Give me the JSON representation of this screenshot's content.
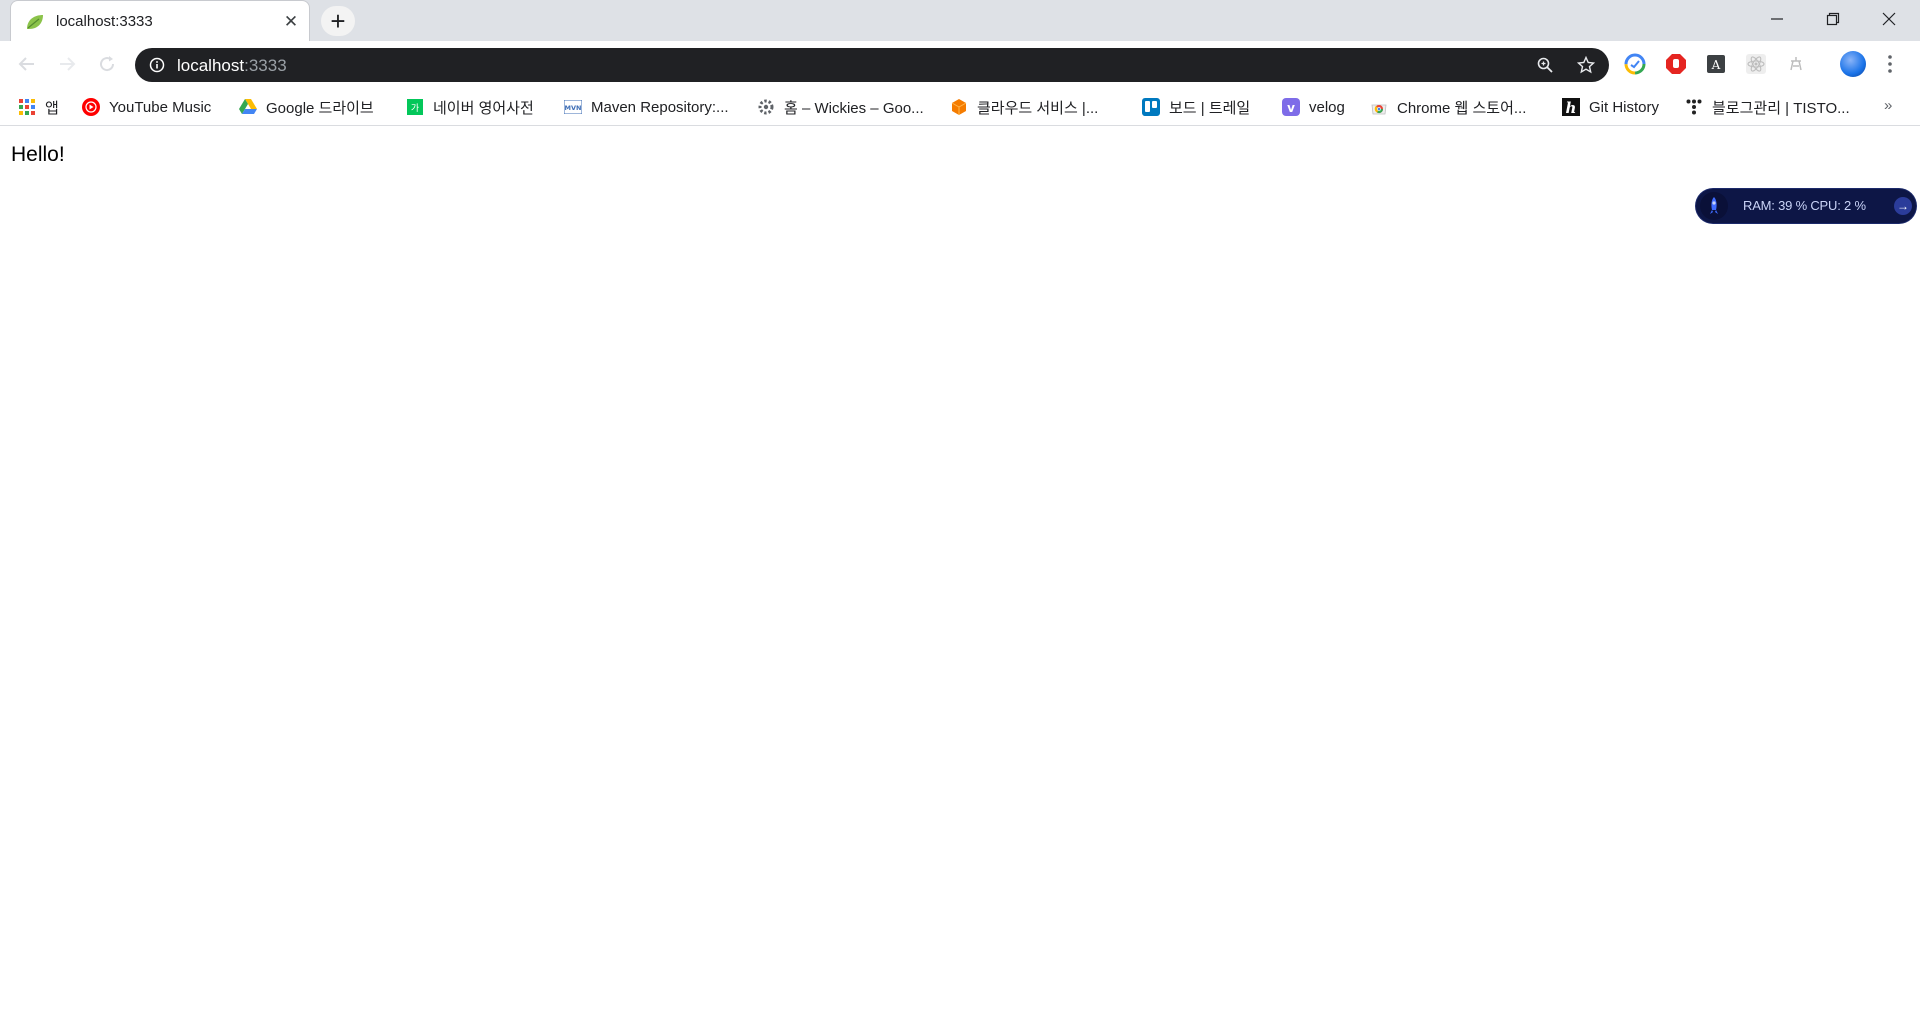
{
  "tab": {
    "title": "localhost:3333",
    "close": "✕"
  },
  "newtab": {
    "label": "+"
  },
  "window": {
    "minimize": "—",
    "restore": "❐",
    "close": "✕"
  },
  "omnibox": {
    "host": "localhost",
    "port": ":3333"
  },
  "bookmarks": [
    {
      "label": "앱",
      "icon": "apps-grid-icon"
    },
    {
      "label": "YouTube Music",
      "icon": "youtube-music-icon"
    },
    {
      "label": "Google 드라이브",
      "icon": "google-drive-icon"
    },
    {
      "label": "네이버 영어사전",
      "icon": "naver-dictionary-icon"
    },
    {
      "label": "Maven Repository:...",
      "icon": "maven-icon"
    },
    {
      "label": "홈 – Wickies – Goo...",
      "icon": "gear-icon"
    },
    {
      "label": "클라우드 서비스 |...",
      "icon": "cloud-cube-icon"
    },
    {
      "label": "보드 | 트레일",
      "icon": "trello-icon"
    },
    {
      "label": "velog",
      "icon": "velog-icon"
    },
    {
      "label": "Chrome 웹 스토어...",
      "icon": "chrome-webstore-icon"
    },
    {
      "label": "Git History",
      "icon": "git-history-icon"
    },
    {
      "label": "블로그관리 | TISTO...",
      "icon": "tistory-icon"
    }
  ],
  "bookmarks_more": "»",
  "page": {
    "text": "Hello!"
  },
  "widget": {
    "text": "RAM: 39 %   CPU: 2 %",
    "arrow": "→"
  },
  "colors": {
    "tabstrip": "#dee1e6",
    "omnibox": "#202124",
    "widget": "#0d1646"
  }
}
